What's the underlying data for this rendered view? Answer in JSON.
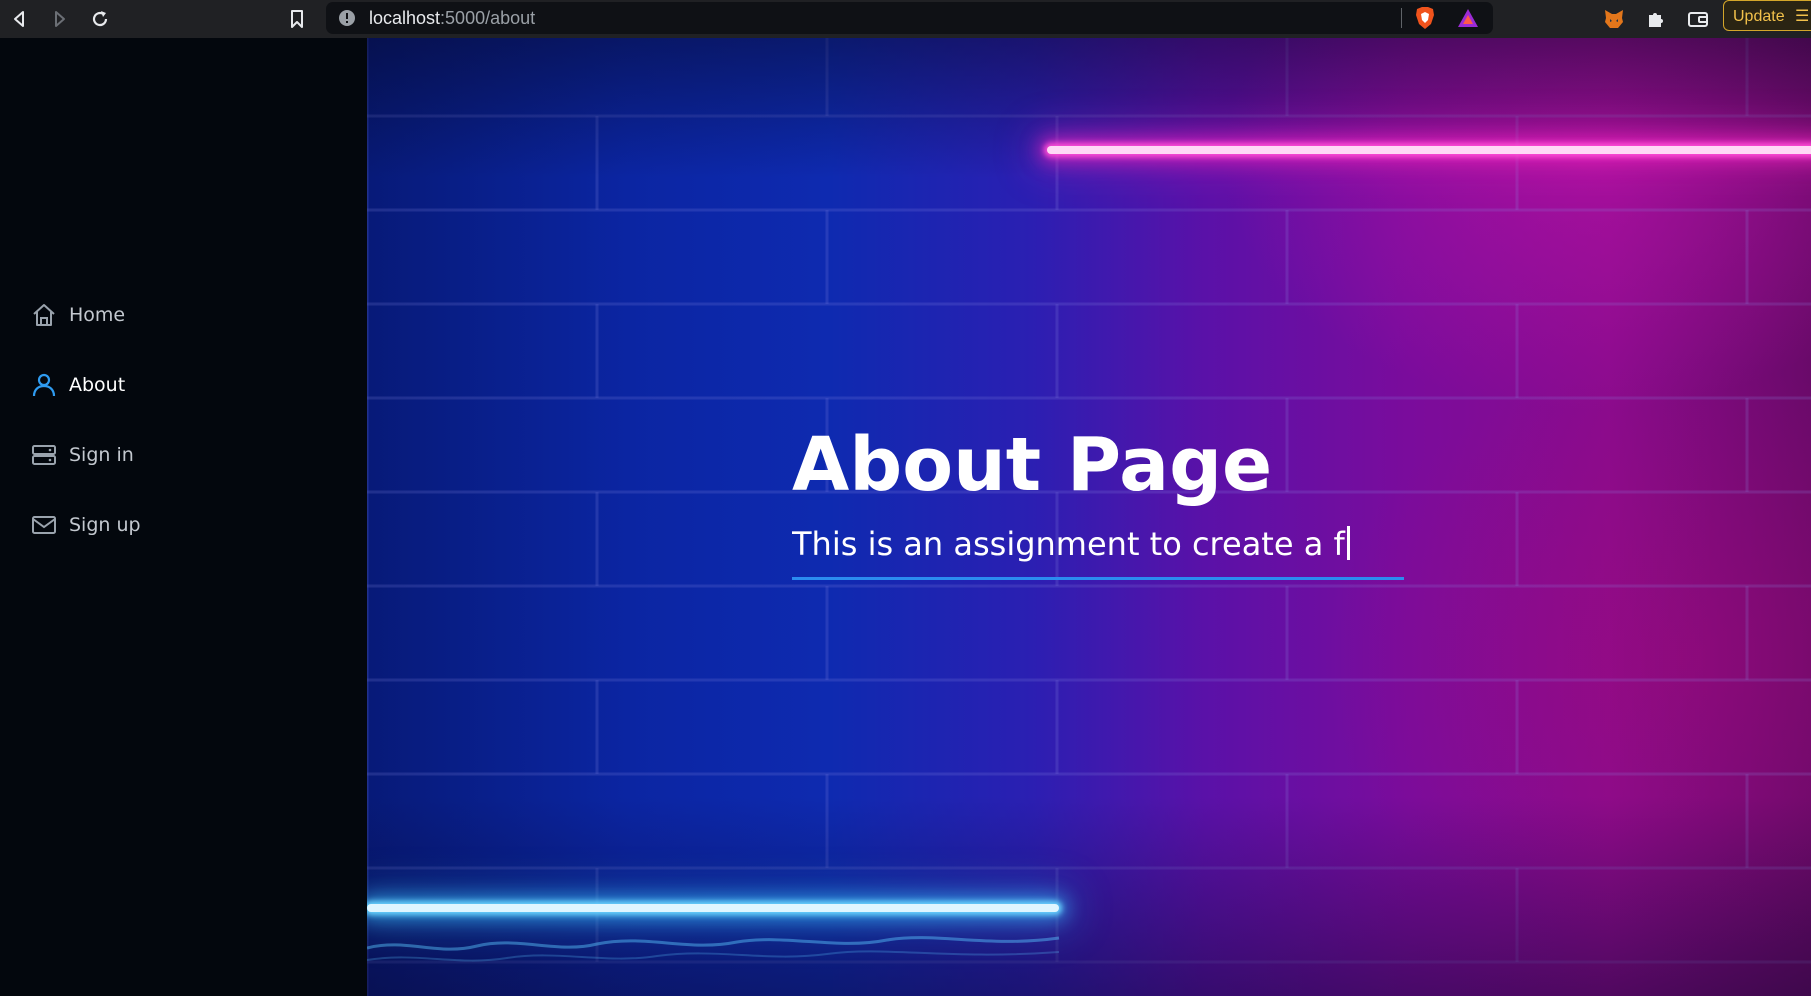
{
  "browser": {
    "url_host": "localhost",
    "url_path": ":5000/about",
    "update_label": "Update"
  },
  "sidebar": {
    "items": [
      {
        "label": "Home",
        "icon": "home-icon",
        "active": false
      },
      {
        "label": "About",
        "icon": "user-icon",
        "active": true
      },
      {
        "label": "Sign in",
        "icon": "server-icon",
        "active": false
      },
      {
        "label": "Sign up",
        "icon": "mail-icon",
        "active": false
      }
    ]
  },
  "hero": {
    "title": "About Page",
    "subtitle": "This is an assignment to create a f"
  },
  "colors": {
    "active_icon": "#2f9bf0",
    "underline": "#2b8cf0",
    "sidebar_bg": "#03070d",
    "update_accent": "#f2c14b"
  }
}
